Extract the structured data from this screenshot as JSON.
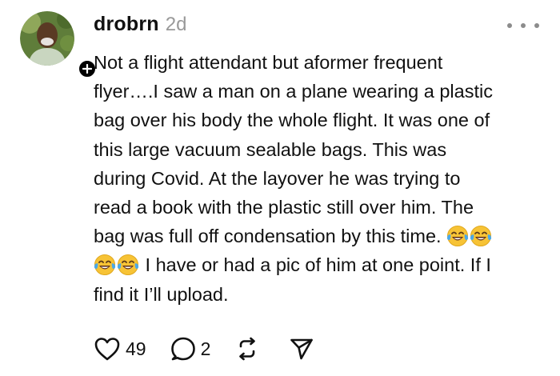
{
  "post": {
    "username": "drobrn",
    "time": "2d",
    "body_lines": [
      "Not a flight attendant but aformer frequent",
      "flyer….I saw a man on a plane wearing a plastic",
      "bag over his body the whole flight.  It was one of",
      "this large vacuum sealable bags.  This was",
      "during Covid.  At the layover he was trying to",
      "read a book with the plastic still over him.  The",
      "bag was full off condensation by this time. ",
      " I have or had a pic of him at one point.  If I",
      "find it I’ll upload."
    ],
    "emojis": [
      "face-with-tears-of-joy",
      "face-with-tears-of-joy",
      "face-with-tears-of-joy",
      "face-with-tears-of-joy"
    ]
  },
  "actions": {
    "like_count": "49",
    "reply_count": "2"
  },
  "icons": {
    "avatar": "avatar",
    "follow": "plus-icon",
    "more": "more-icon",
    "like": "heart-icon",
    "reply": "comment-icon",
    "repost": "repost-icon",
    "share": "send-icon"
  },
  "colors": {
    "text": "#111111",
    "muted": "#999999",
    "emoji_yellow": "#f7c335"
  }
}
